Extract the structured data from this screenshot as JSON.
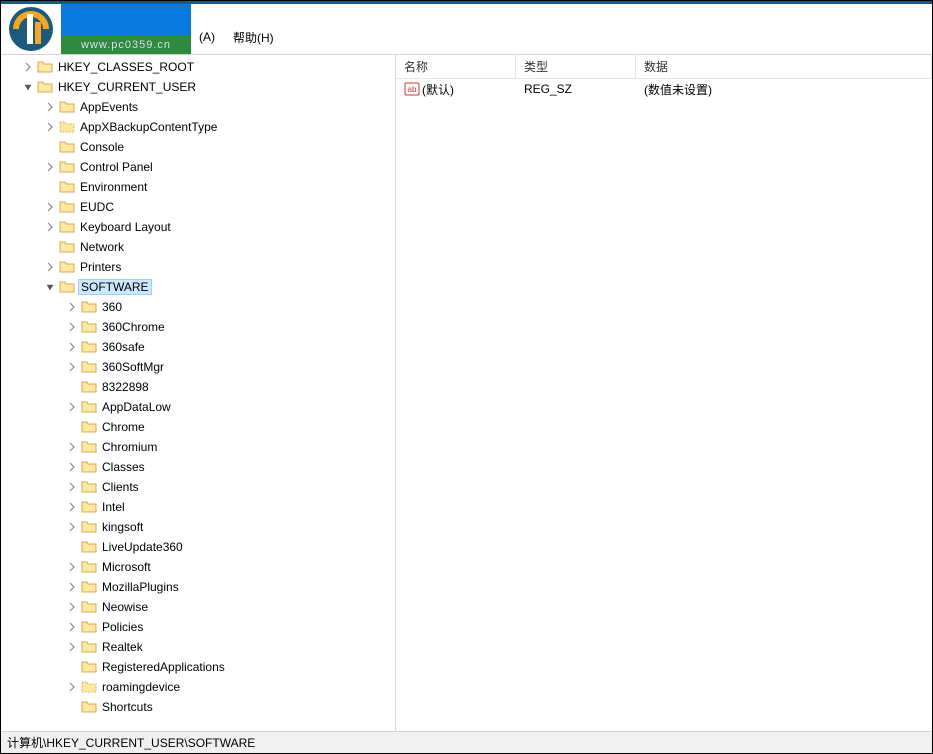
{
  "header": {
    "watermark_url": "www.pc0359.cn"
  },
  "menu": {
    "item_a": "(A)",
    "item_help": "帮助(H)"
  },
  "tree": [
    {
      "depth": 0,
      "exp": ">",
      "label": "HKEY_CLASSES_ROOT",
      "dotted": false
    },
    {
      "depth": 0,
      "exp": "v",
      "label": "HKEY_CURRENT_USER",
      "dotted": false
    },
    {
      "depth": 1,
      "exp": ">",
      "label": "AppEvents",
      "dotted": false
    },
    {
      "depth": 1,
      "exp": ">",
      "label": "AppXBackupContentType",
      "dotted": true
    },
    {
      "depth": 1,
      "exp": "",
      "label": "Console",
      "dotted": false
    },
    {
      "depth": 1,
      "exp": ">",
      "label": "Control Panel",
      "dotted": false
    },
    {
      "depth": 1,
      "exp": "",
      "label": "Environment",
      "dotted": false
    },
    {
      "depth": 1,
      "exp": ">",
      "label": "EUDC",
      "dotted": false
    },
    {
      "depth": 1,
      "exp": ">",
      "label": "Keyboard Layout",
      "dotted": false
    },
    {
      "depth": 1,
      "exp": "",
      "label": "Network",
      "dotted": false
    },
    {
      "depth": 1,
      "exp": ">",
      "label": "Printers",
      "dotted": false
    },
    {
      "depth": 1,
      "exp": "v",
      "label": "SOFTWARE",
      "dotted": false,
      "selected": true
    },
    {
      "depth": 2,
      "exp": ">",
      "label": "360",
      "dotted": false
    },
    {
      "depth": 2,
      "exp": ">",
      "label": "360Chrome",
      "dotted": false
    },
    {
      "depth": 2,
      "exp": ">",
      "label": "360safe",
      "dotted": false
    },
    {
      "depth": 2,
      "exp": ">",
      "label": "360SoftMgr",
      "dotted": false
    },
    {
      "depth": 2,
      "exp": "",
      "label": "8322898",
      "dotted": false
    },
    {
      "depth": 2,
      "exp": ">",
      "label": "AppDataLow",
      "dotted": false
    },
    {
      "depth": 2,
      "exp": "",
      "label": "Chrome",
      "dotted": false
    },
    {
      "depth": 2,
      "exp": ">",
      "label": "Chromium",
      "dotted": false
    },
    {
      "depth": 2,
      "exp": ">",
      "label": "Classes",
      "dotted": false
    },
    {
      "depth": 2,
      "exp": ">",
      "label": "Clients",
      "dotted": false
    },
    {
      "depth": 2,
      "exp": ">",
      "label": "Intel",
      "dotted": false
    },
    {
      "depth": 2,
      "exp": ">",
      "label": "kingsoft",
      "dotted": false
    },
    {
      "depth": 2,
      "exp": "",
      "label": "LiveUpdate360",
      "dotted": false
    },
    {
      "depth": 2,
      "exp": ">",
      "label": "Microsoft",
      "dotted": false
    },
    {
      "depth": 2,
      "exp": ">",
      "label": "MozillaPlugins",
      "dotted": false
    },
    {
      "depth": 2,
      "exp": ">",
      "label": "Neowise",
      "dotted": false
    },
    {
      "depth": 2,
      "exp": ">",
      "label": "Policies",
      "dotted": false
    },
    {
      "depth": 2,
      "exp": ">",
      "label": "Realtek",
      "dotted": false
    },
    {
      "depth": 2,
      "exp": "",
      "label": "RegisteredApplications",
      "dotted": false
    },
    {
      "depth": 2,
      "exp": ">",
      "label": "roamingdevice",
      "dotted": true
    },
    {
      "depth": 2,
      "exp": "",
      "label": "Shortcuts",
      "dotted": false
    }
  ],
  "list": {
    "header": {
      "name": "名称",
      "type": "类型",
      "data": "数据"
    },
    "rows": [
      {
        "name": "(默认)",
        "type": "REG_SZ",
        "data": "(数值未设置)"
      }
    ]
  },
  "statusbar": {
    "path": "计算机\\HKEY_CURRENT_USER\\SOFTWARE"
  }
}
